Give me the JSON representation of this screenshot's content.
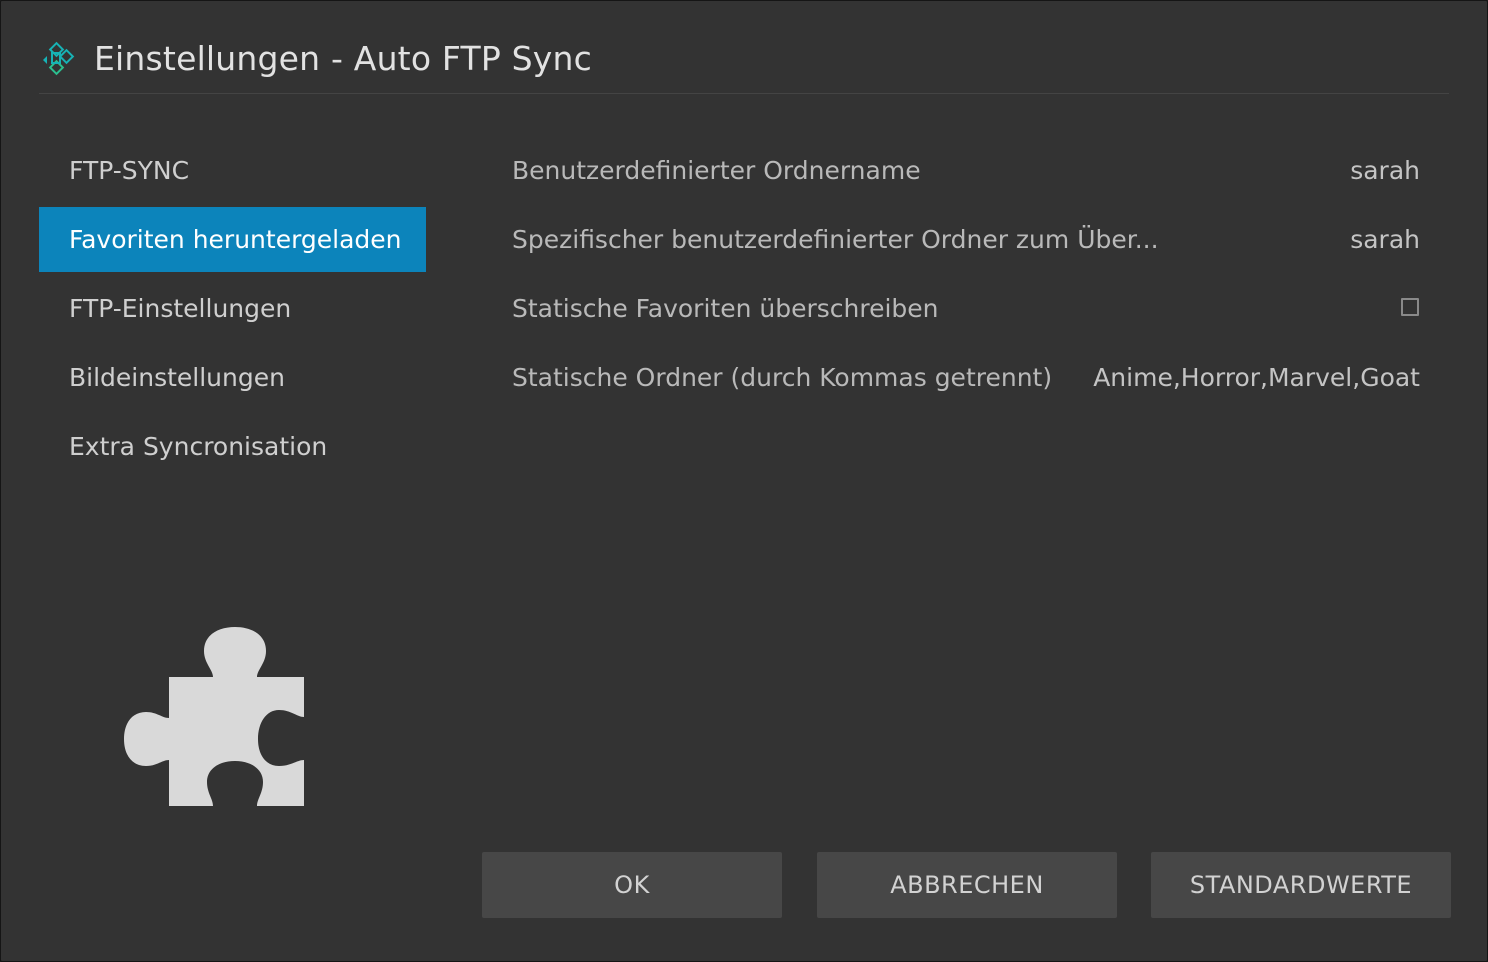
{
  "dialog": {
    "title": "Einstellungen - Auto FTP Sync",
    "logo_icon": "kodi-logo-icon",
    "accent_color": "#0c84bb"
  },
  "categories": [
    {
      "label": "FTP-SYNC",
      "active": false
    },
    {
      "label": "Favoriten heruntergeladen",
      "active": true
    },
    {
      "label": "FTP-Einstellungen",
      "active": false
    },
    {
      "label": "Bildeinstellungen",
      "active": false
    },
    {
      "label": "Extra Syncronisation",
      "active": false
    }
  ],
  "settings": [
    {
      "label": "Benutzerdefinierter Ordnername",
      "value": "sarah"
    },
    {
      "label": "Spezifischer benutzerdefinierter Ordner zum Über...",
      "value": "sarah"
    },
    {
      "label": "Statische Favoriten überschreiben",
      "type": "checkbox",
      "checked": false
    },
    {
      "label": "Statische Ordner (durch Kommas getrennt)",
      "value": "Anime,Horror,Marvel,Goat"
    }
  ],
  "addon_icon": "puzzle-piece-icon",
  "buttons": {
    "ok": "OK",
    "cancel": "ABBRECHEN",
    "defaults": "STANDARDWERTE"
  }
}
